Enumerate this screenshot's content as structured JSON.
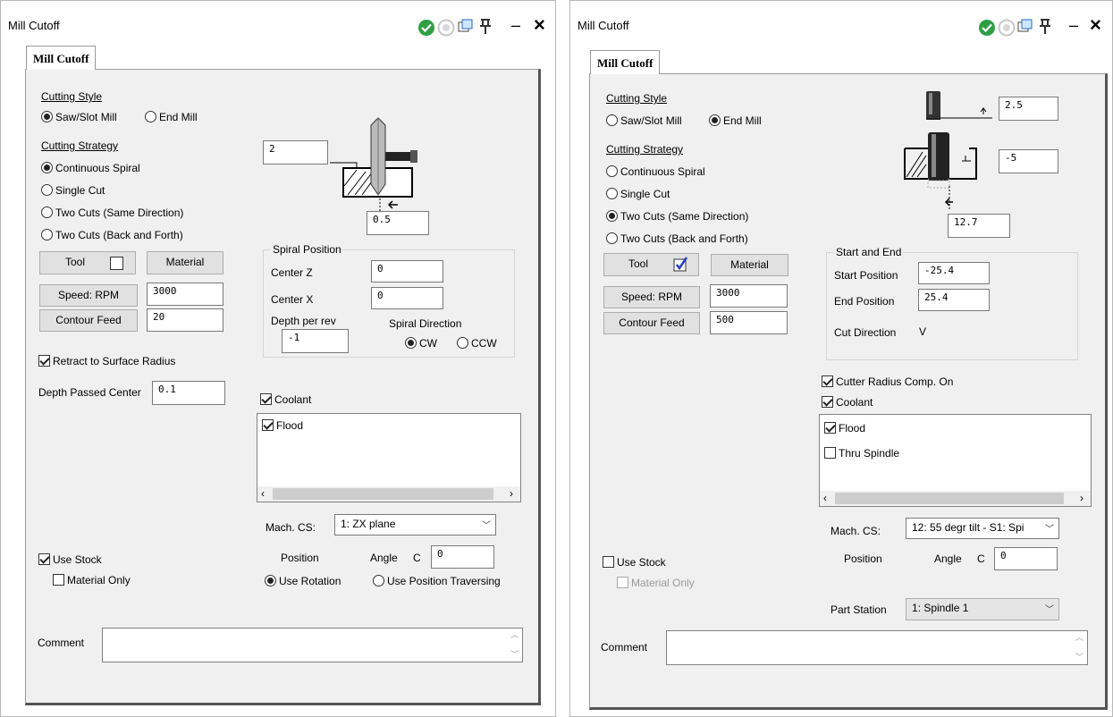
{
  "left": {
    "title": "Mill Cutoff",
    "tab": "Mill Cutoff",
    "cutting_style": {
      "label": "Cutting Style",
      "opt1": "Saw/Slot Mill",
      "opt2": "End Mill"
    },
    "cutting_strategy": {
      "label": "Cutting Strategy",
      "opts": [
        "Continuous Spiral",
        "Single Cut",
        "Two Cuts (Same Direction)",
        "Two Cuts (Back and Forth)"
      ]
    },
    "tool": "Tool",
    "material": "Material",
    "speed_btn": "Speed: RPM",
    "speed_val": "3000",
    "feed_btn": "Contour Feed",
    "feed_val": "20",
    "diag_top": "2",
    "diag_bottom": "0.5",
    "spiral": {
      "title": "Spiral Position",
      "cz_label": "Center Z",
      "cz": "0",
      "cx_label": "Center X",
      "cx": "0",
      "depth_label": "Depth per rev",
      "depth": "-1",
      "dir_label": "Spiral Direction",
      "cw": "CW",
      "ccw": "CCW"
    },
    "retract": "Retract to Surface Radius",
    "depth_passed_label": "Depth Passed Center",
    "depth_passed": "0.1",
    "coolant": "Coolant",
    "flood": "Flood",
    "mach_cs_label": "Mach. CS:",
    "mach_cs": "1: ZX plane",
    "position": "Position",
    "angle": "Angle",
    "angle_axis": "C",
    "angle_val": "0",
    "use_rotation": "Use Rotation",
    "use_pos_trav": "Use Position Traversing",
    "use_stock": "Use Stock",
    "material_only": "Material Only",
    "comment": "Comment"
  },
  "right": {
    "title": "Mill Cutoff",
    "tab": "Mill Cutoff",
    "cutting_style": {
      "label": "Cutting Style",
      "opt1": "Saw/Slot Mill",
      "opt2": "End Mill"
    },
    "cutting_strategy": {
      "label": "Cutting Strategy",
      "opts": [
        "Continuous Spiral",
        "Single Cut",
        "Two Cuts (Same Direction)",
        "Two Cuts (Back and Forth)"
      ]
    },
    "tool": "Tool",
    "material": "Material",
    "speed_btn": "Speed: RPM",
    "speed_val": "3000",
    "feed_btn": "Contour Feed",
    "feed_val": "500",
    "diag_a": "2.5",
    "diag_b": "-5",
    "diag_c": "12.7",
    "start_end": {
      "title": "Start and End",
      "start_label": "Start Position",
      "start": "-25.4",
      "end_label": "End Position",
      "end": "25.4",
      "cutdir_label": "Cut Direction",
      "cutdir": "V"
    },
    "cutter_comp": "Cutter Radius Comp. On",
    "coolant": "Coolant",
    "flood": "Flood",
    "thru": "Thru Spindle",
    "mach_cs_label": "Mach. CS:",
    "mach_cs": "12: 55 degr tilt - S1: Spi",
    "position": "Position",
    "angle": "Angle",
    "angle_axis": "C",
    "angle_val": "0",
    "use_stock": "Use Stock",
    "material_only": "Material Only",
    "part_station_label": "Part Station",
    "part_station": "1: Spindle 1",
    "comment": "Comment"
  },
  "colors": {
    "ok_green": "#2ea043",
    "tab_bg": "#f0f0f0",
    "accent_blue": "#1e3fcf"
  }
}
